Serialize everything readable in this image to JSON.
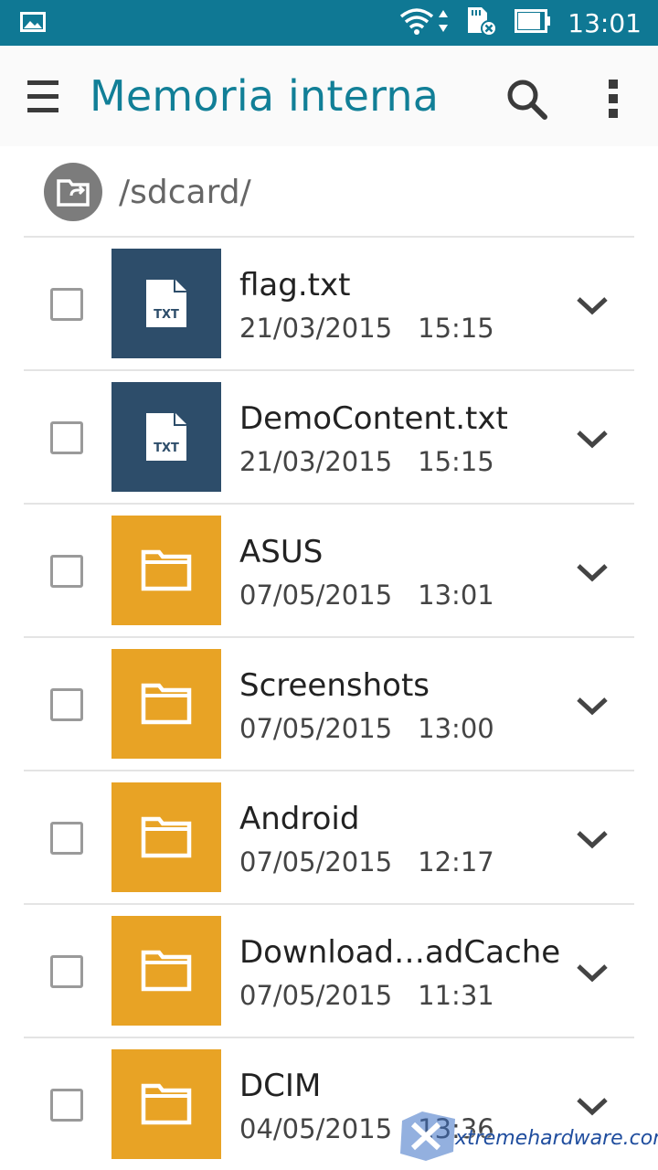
{
  "status_bar": {
    "time": "13:01",
    "icons": [
      "gallery-notification-icon",
      "wifi-icon",
      "data-arrows-icon",
      "sd-card-error-icon",
      "battery-icon"
    ]
  },
  "app_bar": {
    "title": "Memoria interna",
    "icons": [
      "menu-icon",
      "search-icon",
      "more-vert-icon"
    ]
  },
  "path_bar": {
    "path": "/sdcard/",
    "icon": "folder-back-icon"
  },
  "files": [
    {
      "type": "file",
      "thumb_label": "TXT",
      "name": "flag.txt",
      "date": "21/03/2015",
      "time": "15:15"
    },
    {
      "type": "file",
      "thumb_label": "TXT",
      "name": "DemoContent.txt",
      "date": "21/03/2015",
      "time": "15:15"
    },
    {
      "type": "folder",
      "name": "ASUS",
      "date": "07/05/2015",
      "time": "13:01"
    },
    {
      "type": "folder",
      "name": "Screenshots",
      "date": "07/05/2015",
      "time": "13:00"
    },
    {
      "type": "folder",
      "name": "Android",
      "date": "07/05/2015",
      "time": "12:17"
    },
    {
      "type": "folder",
      "name": "Download…adCache",
      "date": "07/05/2015",
      "time": "11:31"
    },
    {
      "type": "folder",
      "name": "DCIM",
      "date": "04/05/2015",
      "time": "13:36"
    }
  ],
  "colors": {
    "status_bar": "#0f7894",
    "title": "#117f97",
    "file_thumb": "#2d4d6a",
    "folder_thumb": "#e8a325"
  },
  "watermark": {
    "text": "xtremehardware.com"
  }
}
